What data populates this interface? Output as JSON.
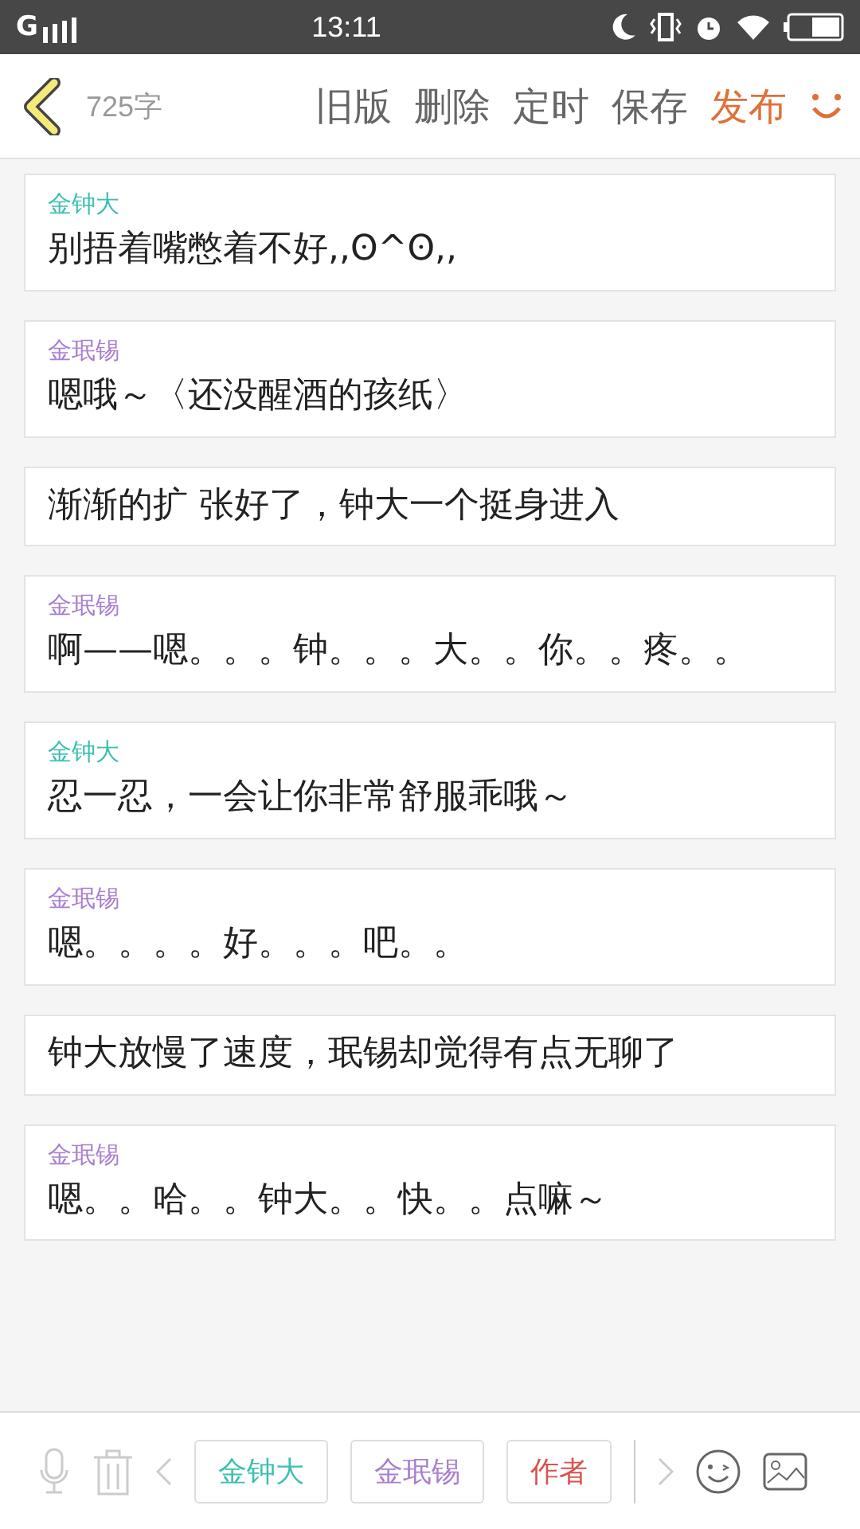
{
  "status_bar": {
    "network": "G",
    "time": "13:11"
  },
  "header": {
    "word_count": "725字",
    "actions": [
      {
        "label": "旧版",
        "kind": "plain"
      },
      {
        "label": "删除",
        "kind": "plain"
      },
      {
        "label": "定时",
        "kind": "plain"
      },
      {
        "label": "保存",
        "kind": "plain"
      },
      {
        "label": "发布",
        "kind": "primary"
      }
    ]
  },
  "messages": [
    {
      "speaker": "金钟大",
      "color": "#3cbfae",
      "text": "别捂着嘴憋着不好,,ʘ^ʘ,,"
    },
    {
      "speaker": "金珉锡",
      "color": "#a97fd0",
      "text": "嗯哦～〈还没醒酒的孩纸〉"
    },
    {
      "text": "渐渐的扩 张好了，钟大一个挺身进入"
    },
    {
      "speaker": "金珉锡",
      "color": "#a97fd0",
      "text": "啊——嗯。。。钟。。。大。。你。。疼。。"
    },
    {
      "speaker": "金钟大",
      "color": "#3cbfae",
      "text": "忍一忍，一会让你非常舒服乖哦～"
    },
    {
      "speaker": "金珉锡",
      "color": "#a97fd0",
      "text": "嗯。。。。好。。。吧。。"
    },
    {
      "text": "钟大放慢了速度，珉锡却觉得有点无聊了"
    },
    {
      "speaker": "金珉锡",
      "color": "#a97fd0",
      "text": "嗯。。哈。。钟大。。快。。点嘛～"
    }
  ],
  "toolbar": {
    "characters": [
      {
        "name": "金钟大",
        "color": "#3cbfae"
      },
      {
        "name": "金珉锡",
        "color": "#a97fd0"
      },
      {
        "name": "作者",
        "color": "#d9534f"
      }
    ]
  }
}
